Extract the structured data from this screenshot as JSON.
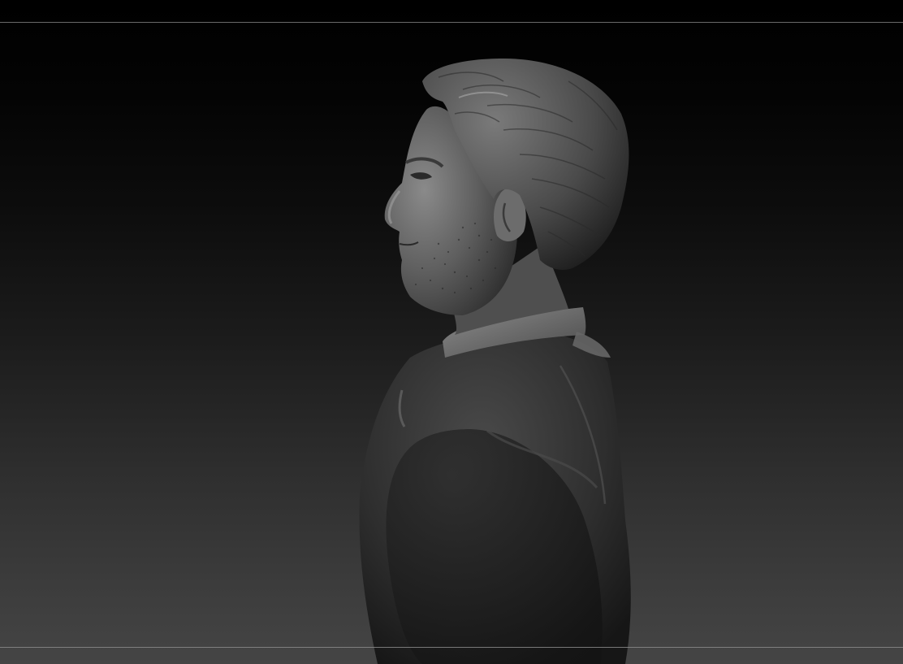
{
  "viewport": {
    "background_top": "#000000",
    "background_bottom": "#454545",
    "guide_line_color": "#7a7a7a"
  },
  "model": {
    "icon": "sculpted-bust-model",
    "material_color": "#5a5a5a"
  }
}
